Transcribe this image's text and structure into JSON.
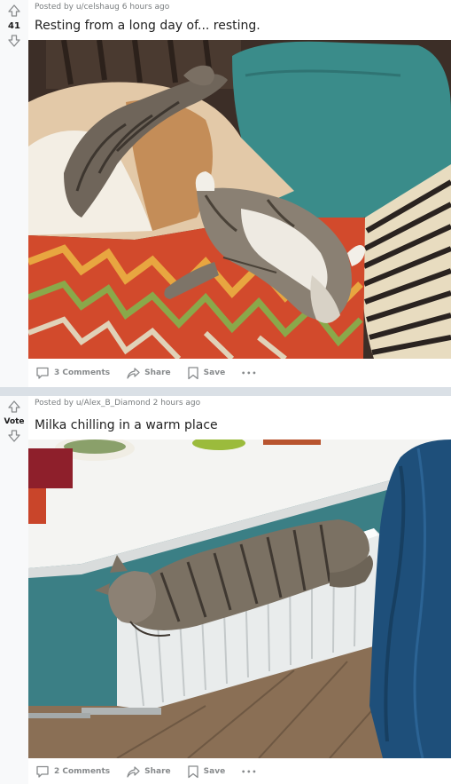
{
  "posts": [
    {
      "author": "Posted by u/celshaug 6 hours ago",
      "score": "41",
      "title": "Resting from a long day of... resting.",
      "comments": "3 Comments",
      "share": "Share",
      "save": "Save",
      "more": "•••"
    },
    {
      "author": "Posted by u/Alex_B_Diamond 2 hours ago",
      "score": "Vote",
      "title": "Milka chilling in a warm place",
      "comments": "2 Comments",
      "share": "Share",
      "save": "Save",
      "more": "•••"
    }
  ]
}
